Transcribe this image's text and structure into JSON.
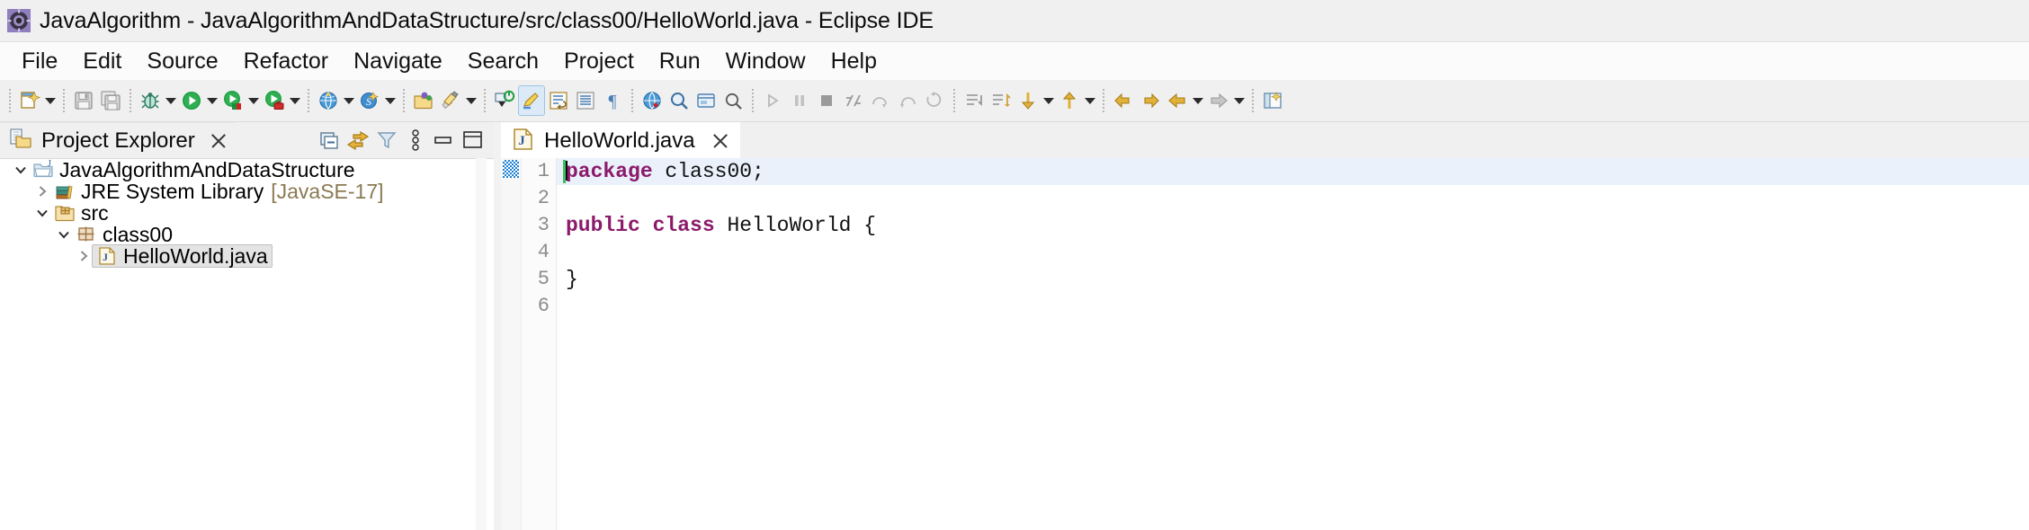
{
  "window": {
    "title": "JavaAlgorithm - JavaAlgorithmAndDataStructure/src/class00/HelloWorld.java - Eclipse IDE",
    "app_icon": "eclipse-icon"
  },
  "menubar": {
    "items": [
      {
        "label": "File"
      },
      {
        "label": "Edit"
      },
      {
        "label": "Source"
      },
      {
        "label": "Refactor"
      },
      {
        "label": "Navigate"
      },
      {
        "label": "Search"
      },
      {
        "label": "Project"
      },
      {
        "label": "Run"
      },
      {
        "label": "Window"
      },
      {
        "label": "Help"
      }
    ]
  },
  "toolbar": {
    "groups": [
      {
        "buttons": [
          {
            "icon": "new-wizard-icon",
            "dropdown": true
          },
          {
            "icon": "save-icon",
            "dropdown": false
          },
          {
            "icon": "save-all-icon",
            "dropdown": false
          }
        ]
      },
      {
        "buttons": [
          {
            "icon": "debug-icon",
            "dropdown": true
          },
          {
            "icon": "run-icon",
            "dropdown": true
          },
          {
            "icon": "run-external-tools-icon",
            "dropdown": true
          },
          {
            "icon": "coverage-icon",
            "dropdown": true
          }
        ]
      },
      {
        "buttons": [
          {
            "icon": "web-browser-icon",
            "dropdown": true
          },
          {
            "icon": "server-icon",
            "dropdown": true
          }
        ]
      },
      {
        "buttons": [
          {
            "icon": "open-type-icon",
            "dropdown": false
          },
          {
            "icon": "new-java-package-icon",
            "dropdown": true
          },
          {
            "icon": "next-annotation-icon",
            "dropdown": false
          },
          {
            "icon": "toggle-mark-occurrences-icon",
            "dropdown": false,
            "active": true
          },
          {
            "icon": "toggle-word-wrap-icon",
            "dropdown": false
          },
          {
            "icon": "toggle-block-selection-icon",
            "dropdown": false
          },
          {
            "icon": "show-whitespace-icon",
            "dropdown": false
          }
        ]
      },
      {
        "buttons": [
          {
            "icon": "open-web-browser-icon",
            "dropdown": false
          },
          {
            "icon": "search-icon",
            "dropdown": false
          },
          {
            "icon": "open-task-icon",
            "dropdown": false
          },
          {
            "icon": "zoom-search-icon",
            "dropdown": false
          }
        ]
      },
      {
        "buttons": [
          {
            "icon": "step-into-icon",
            "dropdown": false
          },
          {
            "icon": "pause-icon",
            "dropdown": false
          },
          {
            "icon": "terminate-icon",
            "dropdown": false
          },
          {
            "icon": "disconnect-icon",
            "dropdown": false
          },
          {
            "icon": "step-over-icon",
            "dropdown": false
          },
          {
            "icon": "step-return-icon",
            "dropdown": false
          },
          {
            "icon": "drop-to-frame-icon",
            "dropdown": false
          }
        ]
      },
      {
        "buttons": [
          {
            "icon": "previous-edit-icon",
            "dropdown": false
          },
          {
            "icon": "next-edit-icon",
            "dropdown": false
          },
          {
            "icon": "next-annotation-down-icon",
            "dropdown": true
          },
          {
            "icon": "previous-annotation-up-icon",
            "dropdown": true
          },
          {
            "icon": "back-history-icon",
            "dropdown": false
          },
          {
            "icon": "forward-history-icon",
            "dropdown": false
          },
          {
            "icon": "back-nav-icon",
            "dropdown": true
          },
          {
            "icon": "forward-nav-icon",
            "dropdown": true
          },
          {
            "icon": "open-perspective-icon",
            "dropdown": false
          }
        ]
      }
    ]
  },
  "project_explorer": {
    "view_title": "Project Explorer",
    "view_icon": "project-explorer-icon",
    "close_icon": "close-icon",
    "toolbar": [
      {
        "icon": "collapse-all-icon"
      },
      {
        "icon": "link-with-editor-icon"
      },
      {
        "icon": "view-filter-icon"
      },
      {
        "icon": "view-menu-icon"
      },
      {
        "icon": "minimize-icon"
      },
      {
        "icon": "maximize-icon"
      }
    ],
    "tree": [
      {
        "label": "JavaAlgorithmAndDataStructure",
        "suffix": "",
        "icon": "java-project-icon",
        "twisty": "expanded",
        "indent": 0,
        "selected": false
      },
      {
        "label": "JRE System Library",
        "suffix": "[JavaSE-17]",
        "icon": "jre-library-icon",
        "twisty": "collapsed",
        "indent": 1,
        "selected": false
      },
      {
        "label": "src",
        "suffix": "",
        "icon": "source-folder-icon",
        "twisty": "expanded",
        "indent": 1,
        "selected": false
      },
      {
        "label": "class00",
        "suffix": "",
        "icon": "package-icon",
        "twisty": "expanded",
        "indent": 2,
        "selected": false
      },
      {
        "label": "HelloWorld.java",
        "suffix": "",
        "icon": "java-file-icon",
        "twisty": "collapsed",
        "indent": 3,
        "selected": true
      }
    ]
  },
  "editor": {
    "tab": {
      "label": "HelloWorld.java",
      "icon": "java-file-icon",
      "close_icon": "close-icon",
      "active": true
    },
    "lines": [
      {
        "number": "1",
        "highlighted": true,
        "annotation": "occurrence-marker",
        "caret": true,
        "tokens": [
          {
            "text": "package",
            "style": "keyword"
          },
          {
            "text": " class00;",
            "style": "plain"
          }
        ]
      },
      {
        "number": "2",
        "highlighted": false,
        "annotation": "",
        "caret": false,
        "tokens": []
      },
      {
        "number": "3",
        "highlighted": false,
        "annotation": "",
        "caret": false,
        "tokens": [
          {
            "text": "public class",
            "style": "keyword"
          },
          {
            "text": " HelloWorld {",
            "style": "plain"
          }
        ]
      },
      {
        "number": "4",
        "highlighted": false,
        "annotation": "",
        "caret": false,
        "tokens": []
      },
      {
        "number": "5",
        "highlighted": false,
        "annotation": "",
        "caret": false,
        "tokens": [
          {
            "text": "}",
            "style": "plain"
          }
        ]
      },
      {
        "number": "6",
        "highlighted": false,
        "annotation": "",
        "caret": false,
        "tokens": []
      }
    ]
  },
  "colors": {
    "keyword": "#8b1a6b",
    "plain_text": "#111111",
    "line_number": "#8c8c8c",
    "current_line_highlight": "#eaf1fb",
    "annotation_blue": "#1b7fd4",
    "selection_gray": "#e4e4e4",
    "library_label": "#8a7a52",
    "titlebar_bg": "#f0f0f0",
    "toolbar_bg": "#f0f0f0",
    "editor_bg": "#ffffff"
  }
}
